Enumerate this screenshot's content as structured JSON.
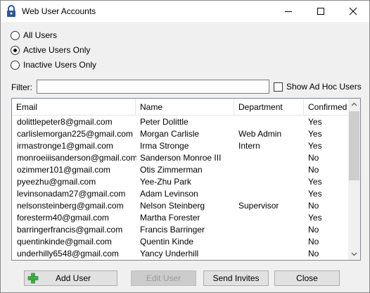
{
  "window": {
    "title": "Web User Accounts"
  },
  "filters": {
    "radios": [
      {
        "label": "All Users",
        "checked": false
      },
      {
        "label": "Active Users Only",
        "checked": true
      },
      {
        "label": "Inactive Users Only",
        "checked": false
      }
    ],
    "filter_label": "Filter:",
    "filter_value": "",
    "show_adhoc_label": "Show Ad Hoc Users",
    "show_adhoc_checked": false
  },
  "table": {
    "columns": [
      "Email",
      "Name",
      "Department",
      "Confirmed"
    ],
    "rows": [
      [
        "dolittlepeter8@gmail.com",
        "Peter Dolittle",
        "",
        "Yes"
      ],
      [
        "carlislemorgan225@gmail.com",
        "Morgan Carlisle",
        "Web Admin",
        "Yes"
      ],
      [
        "irmastronge1@gmail.com",
        "Irma Stronge",
        "Intern",
        "Yes"
      ],
      [
        "monroeiiisanderson@gmail.com",
        "Sanderson Monroe III",
        "",
        "No"
      ],
      [
        "ozimmer101@gmail.com",
        "Otis Zimmerman",
        "",
        "No"
      ],
      [
        "pyeezhu@gmail.com",
        "Yee-Zhu Park",
        "",
        "Yes"
      ],
      [
        "levinsonadam27@gmail.com",
        "Adam Levinson",
        "",
        "Yes"
      ],
      [
        "nelsonsteinberg@gmail.com",
        "Nelson Steinberg",
        "Supervisor",
        "No"
      ],
      [
        "foresterm40@gmail.com",
        "Martha Forester",
        "",
        "Yes"
      ],
      [
        "barringerfrancis@gmail.com",
        "Francis Barringer",
        "",
        "No"
      ],
      [
        "quentinkinde@gmail.com",
        "Quentin Kinde",
        "",
        "No"
      ],
      [
        "underhilly6548@gmail.com",
        "Yancy Underhill",
        "",
        "No"
      ]
    ]
  },
  "buttons": {
    "add_user": "Add User",
    "edit_user": "Edit User",
    "send_invites": "Send Invites",
    "close": "Close"
  },
  "colors": {
    "add_icon": "#3cb043"
  },
  "icons": [
    "lock-icon",
    "minimize-icon",
    "maximize-icon",
    "close-icon",
    "add-icon",
    "scroll-up-icon",
    "scroll-down-icon"
  ]
}
